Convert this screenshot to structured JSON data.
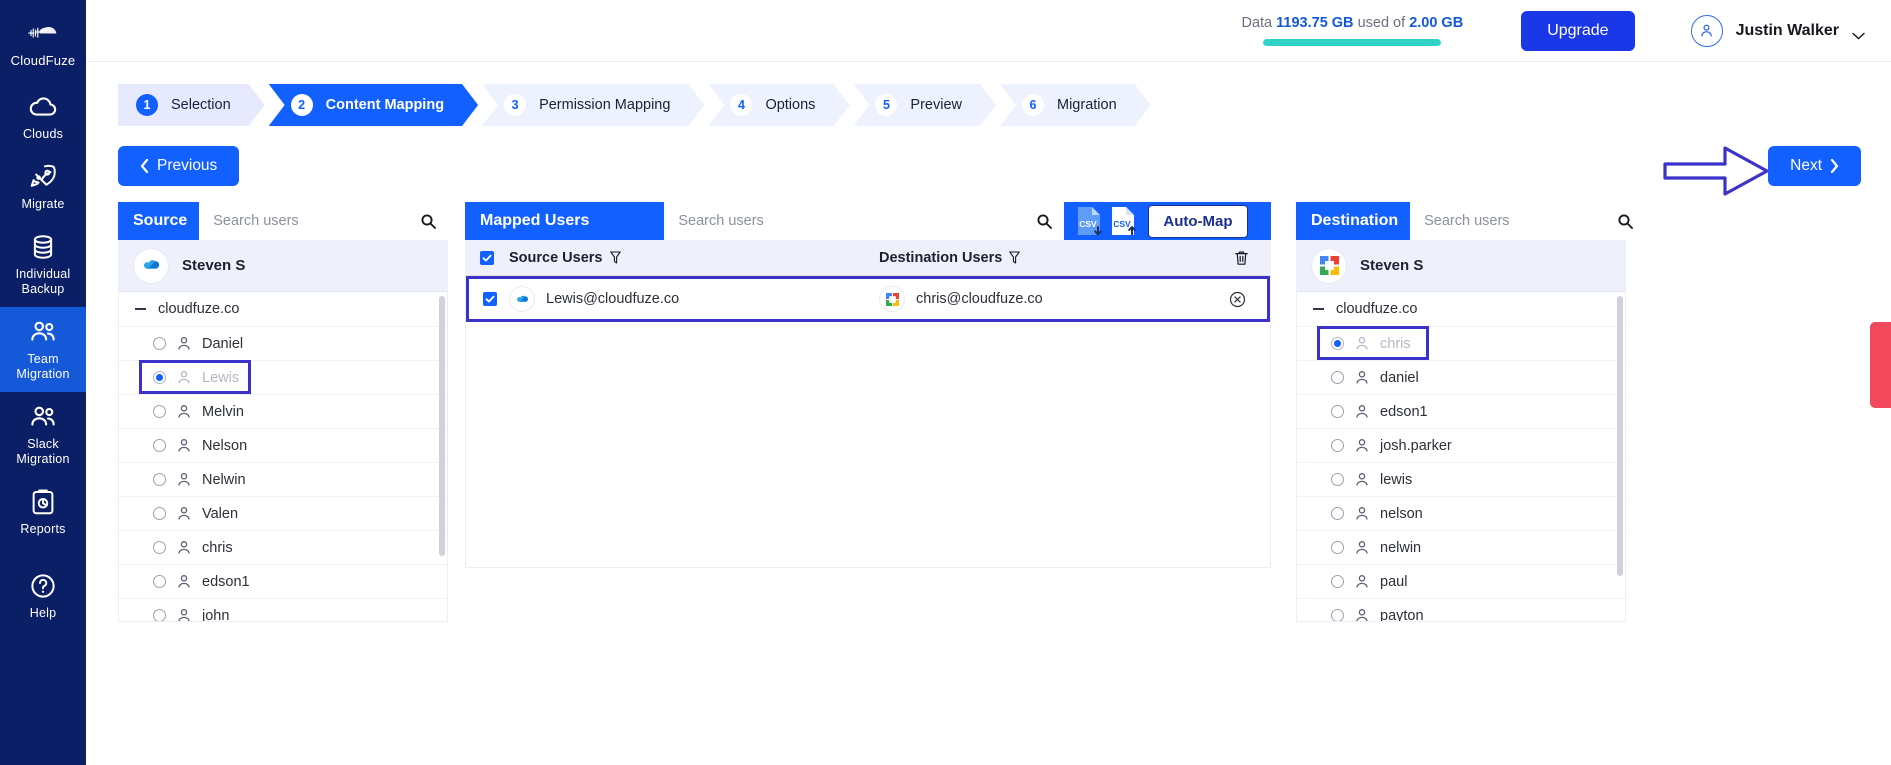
{
  "sidebar": {
    "brand": {
      "label": "CloudFuze",
      "icon": "cloudfuze-logo-icon"
    },
    "items": [
      {
        "label": "Clouds",
        "icon": "cloud-icon",
        "active": false
      },
      {
        "label": "Migrate",
        "icon": "rocket-icon",
        "active": false
      },
      {
        "label": "Individual Backup",
        "icon": "database-icon",
        "active": false
      },
      {
        "label": "Team Migration",
        "icon": "users-icon",
        "active": true
      },
      {
        "label": "Slack Migration",
        "icon": "users-icon",
        "active": false
      },
      {
        "label": "Reports",
        "icon": "clipboard-icon",
        "active": false
      },
      {
        "label": "Help",
        "icon": "question-circle-icon",
        "active": false
      }
    ]
  },
  "header": {
    "quota_prefix": "Data",
    "quota_used": "1193.75 GB",
    "quota_middle": "used of",
    "quota_total": "2.00 GB",
    "quota_percent": 100,
    "upgrade_label": "Upgrade",
    "user_name": "Justin Walker"
  },
  "stepper": {
    "steps": [
      {
        "num": "1",
        "label": "Selection",
        "state": "done"
      },
      {
        "num": "2",
        "label": "Content Mapping",
        "state": "active"
      },
      {
        "num": "3",
        "label": "Permission Mapping",
        "state": "todo"
      },
      {
        "num": "4",
        "label": "Options",
        "state": "todo"
      },
      {
        "num": "5",
        "label": "Preview",
        "state": "todo"
      },
      {
        "num": "6",
        "label": "Migration",
        "state": "todo"
      }
    ]
  },
  "nav": {
    "previous_label": "Previous",
    "next_label": "Next"
  },
  "source_panel": {
    "title": "Source",
    "search_placeholder": "Search users",
    "search_value": "",
    "owner_name": "Steven S",
    "owner_icon": "onedrive-icon",
    "root": "cloudfuze.co",
    "users": [
      {
        "name": "Daniel",
        "selected": false,
        "muted": false,
        "annotated": false
      },
      {
        "name": "Lewis",
        "selected": true,
        "muted": true,
        "annotated": true
      },
      {
        "name": "Melvin",
        "selected": false,
        "muted": false,
        "annotated": false
      },
      {
        "name": "Nelson",
        "selected": false,
        "muted": false,
        "annotated": false
      },
      {
        "name": "Nelwin",
        "selected": false,
        "muted": false,
        "annotated": false
      },
      {
        "name": "Valen",
        "selected": false,
        "muted": false,
        "annotated": false
      },
      {
        "name": "chris",
        "selected": false,
        "muted": false,
        "annotated": false
      },
      {
        "name": "edson1",
        "selected": false,
        "muted": false,
        "annotated": false
      },
      {
        "name": "john",
        "selected": false,
        "muted": false,
        "annotated": false
      }
    ]
  },
  "mapped_panel": {
    "title": "Mapped Users",
    "search_placeholder": "Search users",
    "search_value": "",
    "csv_download_label": "CSV",
    "csv_upload_label": "CSV",
    "automap_label": "Auto-Map",
    "columns": {
      "source": "Source Users",
      "destination": "Destination Users"
    },
    "rows": [
      {
        "checked": true,
        "source_email": "Lewis@cloudfuze.co",
        "source_icon": "onedrive-icon",
        "destination_email": "chris@cloudfuze.co",
        "destination_icon": "google-drive-icon",
        "annotated": true
      }
    ]
  },
  "destination_panel": {
    "title": "Destination",
    "search_placeholder": "Search users",
    "search_value": "",
    "owner_name": "Steven S",
    "owner_icon": "google-workspace-icon",
    "root": "cloudfuze.co",
    "users": [
      {
        "name": "chris",
        "selected": true,
        "muted": true,
        "annotated": true
      },
      {
        "name": "daniel",
        "selected": false,
        "muted": false,
        "annotated": false
      },
      {
        "name": "edson1",
        "selected": false,
        "muted": false,
        "annotated": false
      },
      {
        "name": "josh.parker",
        "selected": false,
        "muted": false,
        "annotated": false
      },
      {
        "name": "lewis",
        "selected": false,
        "muted": false,
        "annotated": false
      },
      {
        "name": "nelson",
        "selected": false,
        "muted": false,
        "annotated": false
      },
      {
        "name": "nelwin",
        "selected": false,
        "muted": false,
        "annotated": false
      },
      {
        "name": "paul",
        "selected": false,
        "muted": false,
        "annotated": false
      },
      {
        "name": "payton",
        "selected": false,
        "muted": false,
        "annotated": false
      }
    ]
  },
  "side_tab": {
    "label": ""
  },
  "colors": {
    "brand_blue": "#1260ff",
    "sidebar_navy": "#0b1f66",
    "upgrade_blue": "#1a37e8",
    "quota_teal": "#2ed3c6",
    "annotation_purple": "#3b33c9",
    "red_tab": "#f2495c"
  }
}
